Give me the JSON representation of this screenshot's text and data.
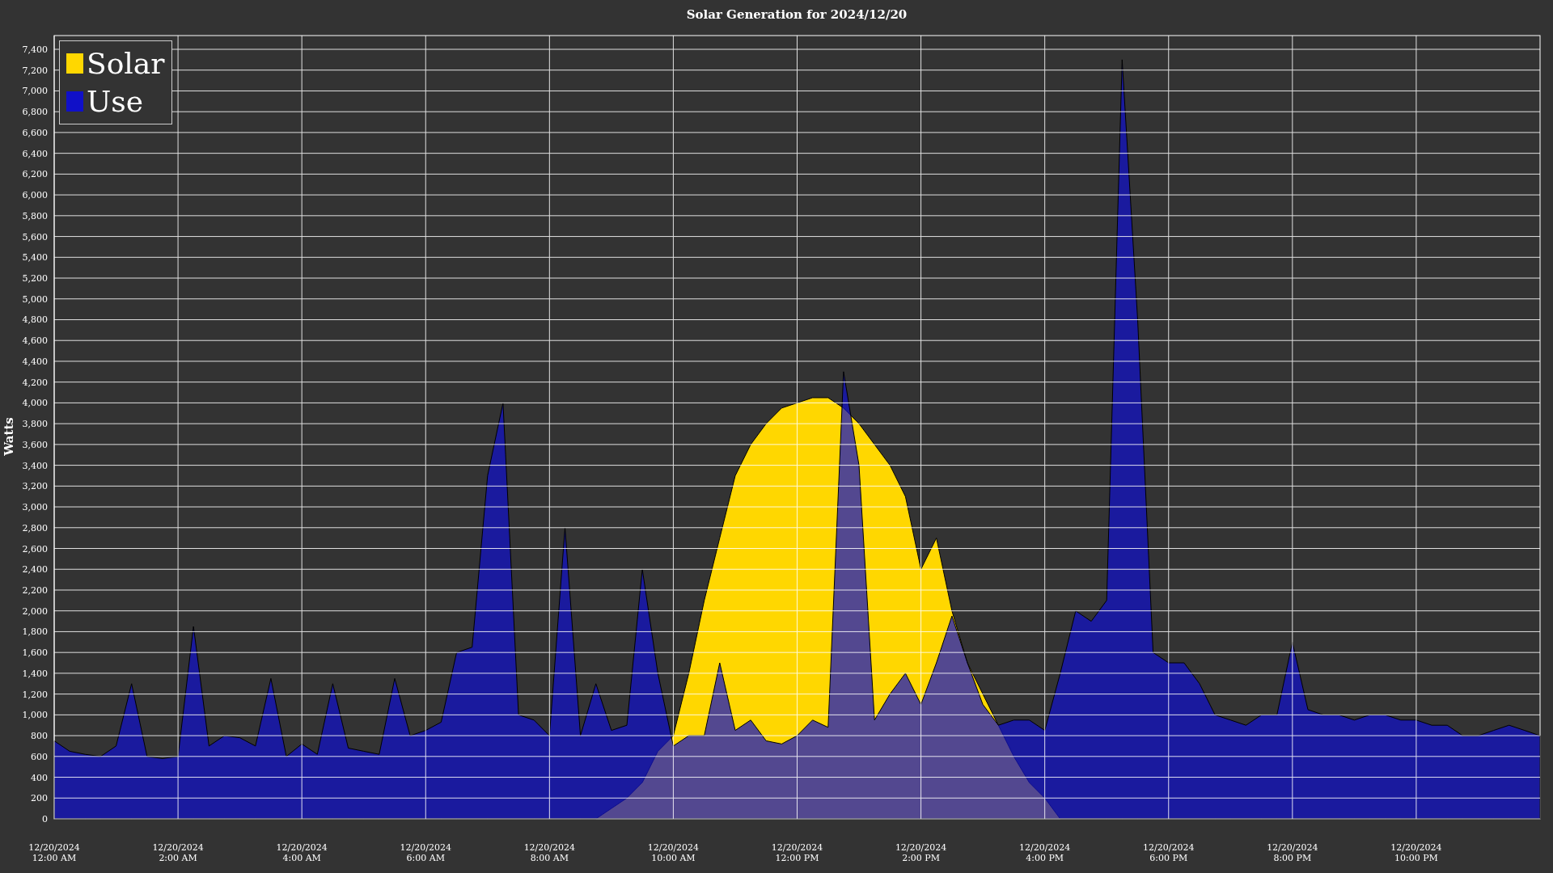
{
  "chart": {
    "chart_data": {
      "type": "area",
      "title": "Solar Generation for 2024/12/20",
      "ylabel": "Watts",
      "categories": [
        "12/20/2024 12:00 AM",
        null,
        null,
        null,
        null,
        null,
        null,
        null,
        "12/20/2024 2:00 AM",
        null,
        null,
        null,
        null,
        null,
        null,
        null,
        "12/20/2024 4:00 AM",
        null,
        null,
        null,
        null,
        null,
        null,
        null,
        "12/20/2024 6:00 AM",
        null,
        null,
        null,
        null,
        null,
        null,
        null,
        "12/20/2024 8:00 AM",
        null,
        null,
        null,
        null,
        null,
        null,
        null,
        "12/20/2024 10:00 AM",
        null,
        null,
        null,
        null,
        null,
        null,
        null,
        "12/20/2024 12:00 PM",
        null,
        null,
        null,
        null,
        null,
        null,
        null,
        "12/20/2024 2:00 PM",
        null,
        null,
        null,
        null,
        null,
        null,
        null,
        "12/20/2024 4:00 PM",
        null,
        null,
        null,
        null,
        null,
        null,
        null,
        "12/20/2024 6:00 PM",
        null,
        null,
        null,
        null,
        null,
        null,
        null,
        "12/20/2024 8:00 PM",
        null,
        null,
        null,
        null,
        null,
        null,
        null,
        "12/20/2024 10:00 PM",
        null,
        null,
        null,
        null,
        null,
        null,
        null,
        null
      ],
      "series": [
        {
          "name": "Solar",
          "color": "#ffd700",
          "values": [
            0,
            0,
            0,
            0,
            0,
            0,
            0,
            0,
            0,
            0,
            0,
            0,
            0,
            0,
            0,
            0,
            0,
            0,
            0,
            0,
            0,
            0,
            0,
            0,
            0,
            0,
            0,
            0,
            0,
            0,
            0,
            0,
            0,
            0,
            0,
            0,
            100,
            200,
            350,
            650,
            800,
            1400,
            2100,
            2700,
            3300,
            3600,
            3800,
            3950,
            4000,
            4050,
            4050,
            3950,
            3800,
            3600,
            3400,
            3100,
            2400,
            2700,
            2000,
            1500,
            1200,
            900,
            600,
            350,
            200,
            0,
            0,
            0,
            0,
            0,
            0,
            0,
            0,
            0,
            0,
            0,
            0,
            0,
            0,
            0,
            0,
            0,
            0,
            0,
            0,
            0,
            0,
            0,
            0,
            0,
            0,
            0,
            0,
            0,
            0,
            0,
            0
          ]
        },
        {
          "name": "Use",
          "color": "#1010c8",
          "values": [
            750,
            650,
            620,
            600,
            700,
            1300,
            600,
            580,
            600,
            1850,
            700,
            800,
            780,
            700,
            1350,
            600,
            720,
            620,
            1300,
            680,
            650,
            620,
            1350,
            800,
            850,
            930,
            1600,
            1650,
            3300,
            4000,
            1000,
            950,
            800,
            2800,
            800,
            1300,
            850,
            900,
            2400,
            1400,
            700,
            800,
            800,
            1500,
            850,
            950,
            750,
            720,
            800,
            950,
            880,
            4300,
            3400,
            950,
            1200,
            1400,
            1100,
            1500,
            1950,
            1500,
            1100,
            900,
            950,
            950,
            850,
            1400,
            2000,
            1900,
            2100,
            7300,
            4800,
            1600,
            1500,
            1500,
            1300,
            1000,
            950,
            900,
            1000,
            1000,
            1700,
            1050,
            1000,
            1000,
            950,
            1000,
            1000,
            950,
            950,
            900,
            900,
            800,
            800,
            850,
            900,
            850,
            800
          ]
        }
      ],
      "ylim": [
        0,
        7400
      ],
      "grid": true,
      "legend": true,
      "yticks": [
        {
          "value": 0,
          "label": "0"
        },
        {
          "value": 200,
          "label": "200"
        },
        {
          "value": 400,
          "label": "400"
        },
        {
          "value": 600,
          "label": "600"
        },
        {
          "value": 800,
          "label": "800"
        },
        {
          "value": 1000,
          "label": "1,000"
        },
        {
          "value": 1200,
          "label": "1,200"
        },
        {
          "value": 1400,
          "label": "1,400"
        },
        {
          "value": 1600,
          "label": "1,600"
        },
        {
          "value": 1800,
          "label": "1,800"
        },
        {
          "value": 2000,
          "label": "2,000"
        },
        {
          "value": 2200,
          "label": "2,200"
        },
        {
          "value": 2400,
          "label": "2,400"
        },
        {
          "value": 2600,
          "label": "2,600"
        },
        {
          "value": 2800,
          "label": "2,800"
        },
        {
          "value": 3000,
          "label": "3,000"
        },
        {
          "value": 3200,
          "label": "3,200"
        },
        {
          "value": 3400,
          "label": "3,400"
        },
        {
          "value": 3600,
          "label": "3,600"
        },
        {
          "value": 3800,
          "label": "3,800"
        },
        {
          "value": 4000,
          "label": "4,000"
        },
        {
          "value": 4200,
          "label": "4,200"
        },
        {
          "value": 4400,
          "label": "4,400"
        },
        {
          "value": 4600,
          "label": "4,600"
        },
        {
          "value": 4800,
          "label": "4,800"
        },
        {
          "value": 5000,
          "label": "5,000"
        },
        {
          "value": 5200,
          "label": "5,200"
        },
        {
          "value": 5400,
          "label": "5,400"
        },
        {
          "value": 5600,
          "label": "5,600"
        },
        {
          "value": 5800,
          "label": "5,800"
        },
        {
          "value": 6000,
          "label": "6,000"
        },
        {
          "value": 6200,
          "label": "6,200"
        },
        {
          "value": 6400,
          "label": "6,400"
        },
        {
          "value": 6600,
          "label": "6,600"
        },
        {
          "value": 6800,
          "label": "6,800"
        },
        {
          "value": 7000,
          "label": "7,000"
        },
        {
          "value": 7200,
          "label": "7,200"
        },
        {
          "value": 7400,
          "label": "7,400"
        }
      ]
    }
  }
}
